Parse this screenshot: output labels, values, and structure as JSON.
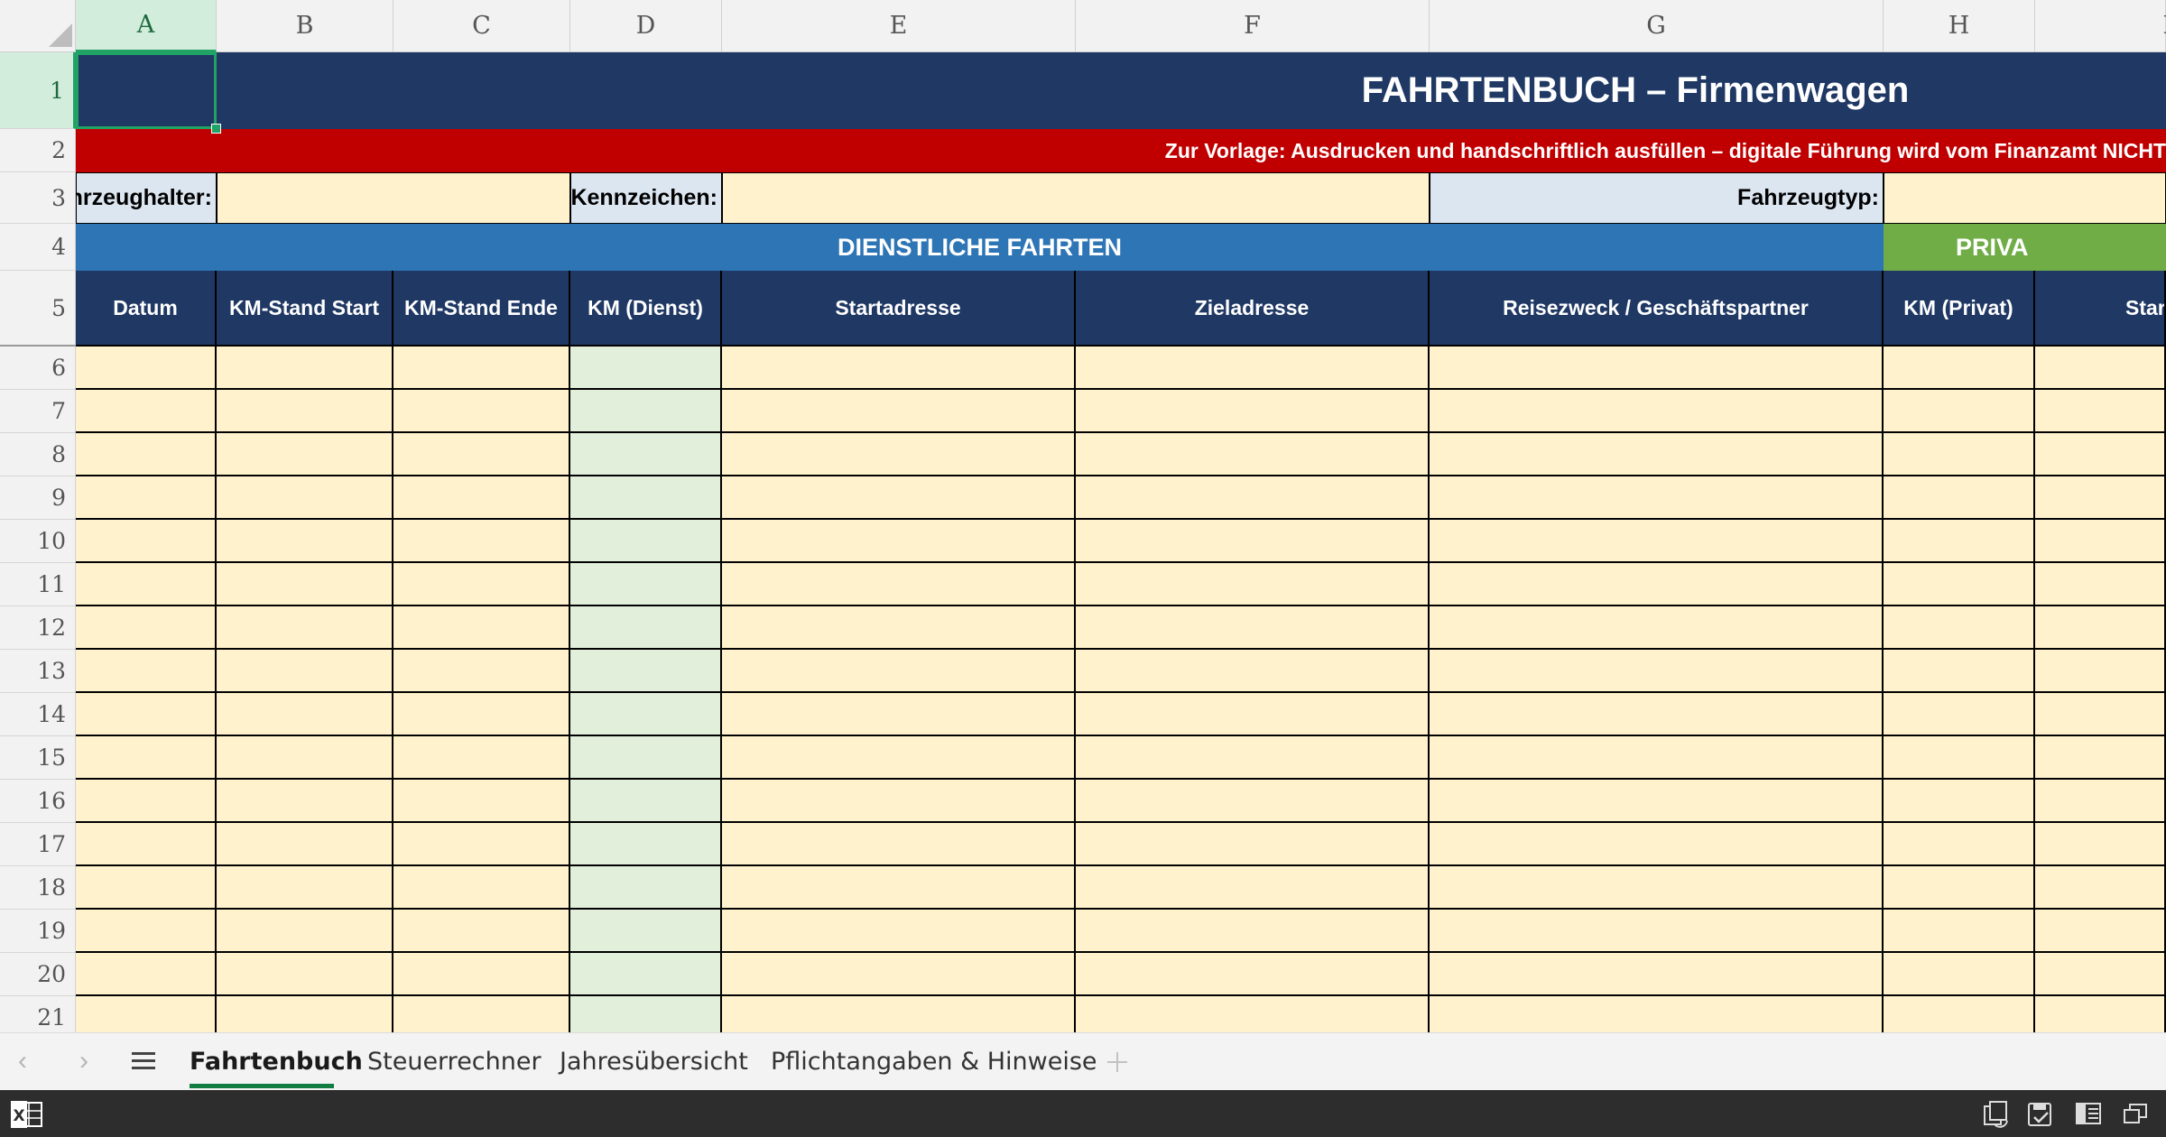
{
  "sheet": {
    "title": "FAHRTENBUCH – Firmenwagen",
    "notice": "Zur Vorlage: Ausdrucken und handschriftlich ausfüllen – digitale Führung wird vom Finanzamt NICHT",
    "labels": {
      "holder": "hrzeughalter:",
      "plate": "Kennzeichen:",
      "vehicle_type": "Fahrzeugtyp:"
    },
    "section_business": "DIENSTLICHE FAHRTEN",
    "section_private": "PRIVA",
    "headers": [
      "Datum",
      "KM-Stand Start",
      "KM-Stand Ende",
      "KM (Dienst)",
      "Startadresse",
      "Zieladresse",
      "Reisezweck / Geschäftspartner",
      "KM (Privat)",
      "Star"
    ]
  },
  "columns": [
    "A",
    "B",
    "C",
    "D",
    "E",
    "F",
    "G",
    "H",
    "I"
  ],
  "rows": [
    "1",
    "2",
    "3",
    "4",
    "5",
    "6",
    "7",
    "8",
    "9",
    "10",
    "11",
    "12",
    "13",
    "14",
    "15",
    "16",
    "17",
    "18",
    "19",
    "20",
    "21"
  ],
  "selected_cell": "A1",
  "tabs": {
    "items": [
      "Fahrtenbuch",
      "Steuerrechner",
      "Jahresübersicht",
      "Pflichtangaben & Hinweise"
    ],
    "active": "Fahrtenbuch",
    "add_icon": "plus-icon",
    "prev_icon": "chevron-left-icon",
    "next_icon": "chevron-right-icon",
    "menu_icon": "hamburger-icon"
  },
  "colors": {
    "title_bg": "#1f3864",
    "notice_bg": "#c00000",
    "business_band": "#2e75b6",
    "private_band": "#70ad47",
    "input_fill": "#fff2cc",
    "km_fill": "#e2efda",
    "selection": "#21a366"
  },
  "statusbar_icons": [
    "excel-icon",
    "sync-icon",
    "save-icon",
    "layout-icon",
    "window-icon"
  ]
}
